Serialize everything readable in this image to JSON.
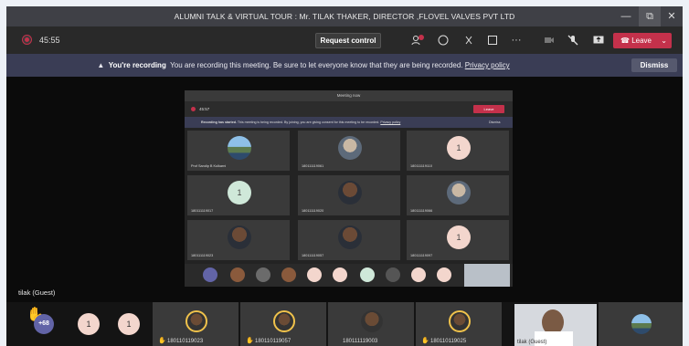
{
  "window": {
    "title": "ALUMNI TALK & VIRTUAL TOUR : Mr. TILAK THAKER, DIRECTOR ,FLOVEL VALVES PVT LTD",
    "minimize": "—",
    "restore": "⧉",
    "close": "✕"
  },
  "toolbar": {
    "timer": "45:55",
    "request_control": "Request control",
    "leave": "Leave",
    "participants_badge": "6"
  },
  "banner": {
    "title": "You're recording",
    "message": "You are recording this meeting. Be sure to let everyone know that they are being recorded.",
    "link": "Privacy policy",
    "dismiss": "Dismiss"
  },
  "shared_screen": {
    "title": "Meeting now",
    "timer": "45:57",
    "leave": "Leave",
    "banner_title": "Recording has started.",
    "banner_text": "This meeting is being recorded. By joining, you are giving consent for this meeting to be recorded.",
    "banner_link": "Privacy policy",
    "dismiss": "Dismiss",
    "cells": [
      {
        "name": "Prof Sandip B Kulkarni",
        "avatar": "landscape"
      },
      {
        "name": "180111119061",
        "avatar": "photo"
      },
      {
        "name": "180111119110",
        "avatar": "1"
      },
      {
        "name": "180111119017",
        "avatar": "1"
      },
      {
        "name": "180111119020",
        "avatar": "photo"
      },
      {
        "name": "180111119066",
        "avatar": "photo"
      },
      {
        "name": "180111119023",
        "avatar": "photo"
      },
      {
        "name": "180111119057",
        "avatar": "photo"
      },
      {
        "name": "180111119097",
        "avatar": "1"
      }
    ]
  },
  "stage": {
    "guest_label": "tilak (Guest)"
  },
  "bottom_strip": {
    "more_count": "+68",
    "initials": [
      "1",
      "1"
    ],
    "tiles": [
      {
        "name": "180110119023"
      },
      {
        "name": "180110119057"
      },
      {
        "name": "180111119003"
      },
      {
        "name": "180110119025"
      }
    ],
    "self_label": "tilak (Guest)"
  }
}
